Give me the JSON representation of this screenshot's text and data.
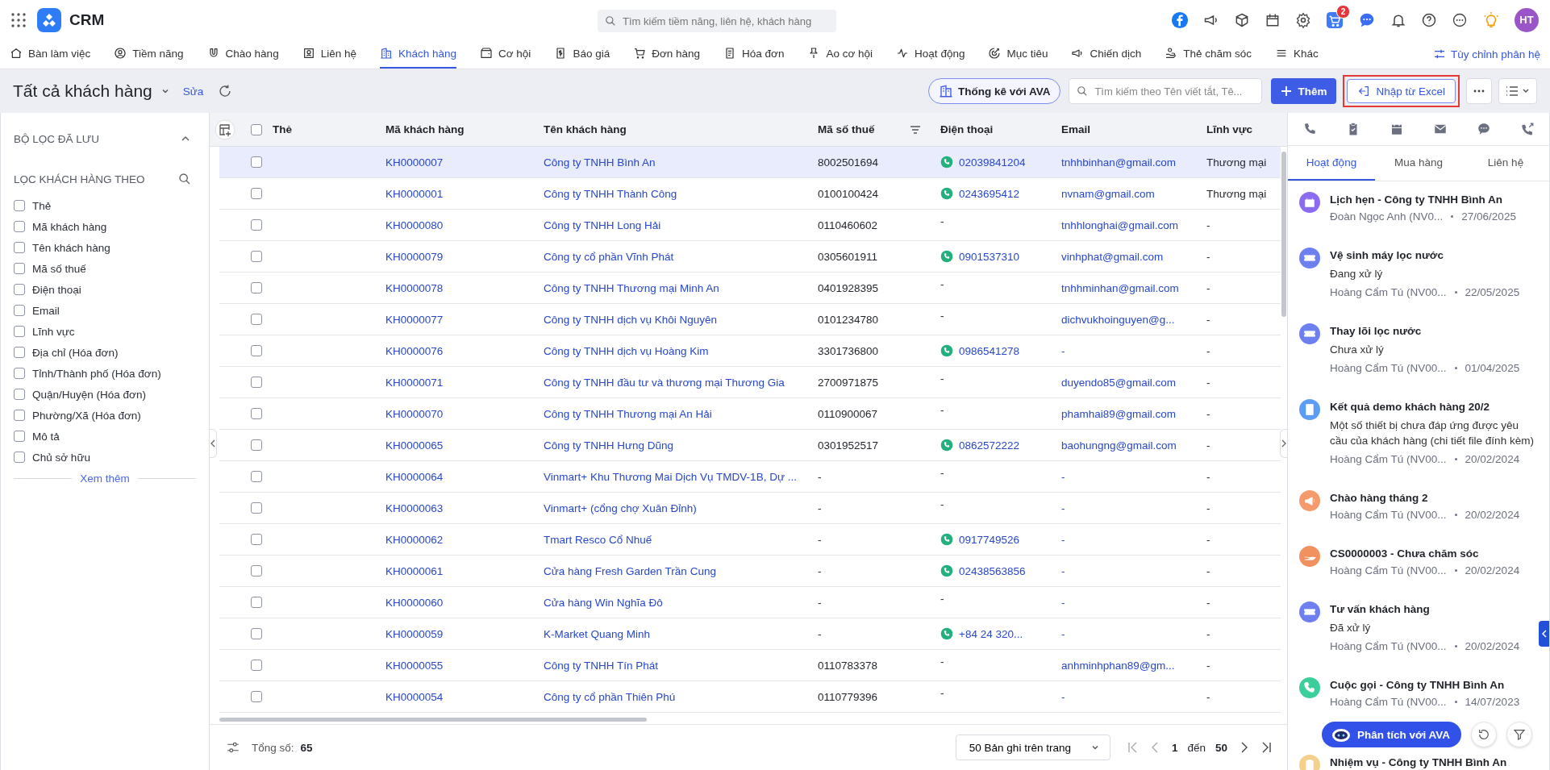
{
  "app": {
    "name": "CRM",
    "search_placeholder": "Tìm kiếm tiềm năng, liên hệ, khách hàng",
    "cart_badge": "2",
    "avatar": "HT"
  },
  "nav": {
    "items": [
      {
        "label": "Bàn làm việc",
        "selected": false
      },
      {
        "label": "Tiềm năng",
        "selected": false
      },
      {
        "label": "Chào hàng",
        "selected": false
      },
      {
        "label": "Liên hệ",
        "selected": false
      },
      {
        "label": "Khách hàng",
        "selected": true
      },
      {
        "label": "Cơ hội",
        "selected": false
      },
      {
        "label": "Báo giá",
        "selected": false
      },
      {
        "label": "Đơn hàng",
        "selected": false
      },
      {
        "label": "Hóa đơn",
        "selected": false
      },
      {
        "label": "Ao cơ hội",
        "selected": false
      },
      {
        "label": "Hoạt động",
        "selected": false
      },
      {
        "label": "Mục tiêu",
        "selected": false
      },
      {
        "label": "Chiến dịch",
        "selected": false
      },
      {
        "label": "Thẻ chăm sóc",
        "selected": false
      },
      {
        "label": "Khác",
        "selected": false
      }
    ],
    "customize": "Tùy chỉnh phân hệ"
  },
  "toolbar": {
    "title": "Tất cả khách hàng",
    "edit": "Sửa",
    "ava_button": "Thống kê với AVA",
    "search_placeholder": "Tìm kiếm theo Tên viết tắt, Tê...",
    "add_button": "Thêm",
    "import_button": {
      "label": "Nhập từ Excel",
      "highlighted": true
    }
  },
  "filters": {
    "saved_title": "BỘ LỌC ĐÃ LƯU",
    "filter_title": "LỌC KHÁCH HÀNG THEO",
    "items": [
      {
        "label": "Thẻ",
        "checked": false
      },
      {
        "label": "Mã khách hàng",
        "checked": false
      },
      {
        "label": "Tên khách hàng",
        "checked": false
      },
      {
        "label": "Mã số thuế",
        "checked": false
      },
      {
        "label": "Điện thoại",
        "checked": false
      },
      {
        "label": "Email",
        "checked": false
      },
      {
        "label": "Lĩnh vực",
        "checked": false
      },
      {
        "label": "Địa chỉ (Hóa đơn)",
        "checked": false
      },
      {
        "label": "Tỉnh/Thành phố (Hóa đơn)",
        "checked": false
      },
      {
        "label": "Quận/Huyện (Hóa đơn)",
        "checked": false
      },
      {
        "label": "Phường/Xã (Hóa đơn)",
        "checked": false
      },
      {
        "label": "Mô tả",
        "checked": false
      },
      {
        "label": "Chủ sở hữu",
        "checked": false
      }
    ],
    "more": "Xem thêm"
  },
  "table": {
    "columns": [
      "Thẻ",
      "Mã khách hàng",
      "Tên khách hàng",
      "Mã số thuế",
      "Điện thoại",
      "Email",
      "Lĩnh vực"
    ],
    "select_all_checked": false,
    "rows": [
      {
        "selected": true,
        "checked": false,
        "code": "KH0000007",
        "name": "Công ty TNHH Bình An",
        "tax_code": "8002501694",
        "phone": "02039841204",
        "phone_icon": true,
        "email": "tnhhbinhan@gmail.com",
        "field": "Thương mại"
      },
      {
        "selected": false,
        "checked": false,
        "code": "KH0000001",
        "name": "Công ty TNHH Thành Công",
        "tax_code": "0100100424",
        "phone": "0243695412",
        "phone_icon": true,
        "email": "nvnam@gmail.com",
        "field": "Thương mại"
      },
      {
        "selected": false,
        "checked": false,
        "code": "KH0000080",
        "name": "Công ty TNHH Long Hải",
        "tax_code": "0110460602",
        "phone": "-",
        "phone_icon": false,
        "email": "tnhhlonghai@gmail.com",
        "field": "-"
      },
      {
        "selected": false,
        "checked": false,
        "code": "KH0000079",
        "name": "Công ty cổ phần Vĩnh Phát",
        "tax_code": "0305601911",
        "phone": "0901537310",
        "phone_icon": true,
        "email": "vinhphat@gmail.com",
        "field": "-"
      },
      {
        "selected": false,
        "checked": false,
        "code": "KH0000078",
        "name": "Công ty TNHH Thương mại Minh An",
        "tax_code": "0401928395",
        "phone": "-",
        "phone_icon": false,
        "email": "tnhhminhan@gmail.com",
        "field": "-"
      },
      {
        "selected": false,
        "checked": false,
        "code": "KH0000077",
        "name": "Công ty TNHH dịch vụ Khôi Nguyên",
        "tax_code": "0101234780",
        "phone": "-",
        "phone_icon": false,
        "email": "dichvukhoinguyen@g...",
        "field": "-"
      },
      {
        "selected": false,
        "checked": false,
        "code": "KH0000076",
        "name": "Công ty TNHH dịch vụ Hoàng Kim",
        "tax_code": "3301736800",
        "phone": "0986541278",
        "phone_icon": true,
        "email": "-",
        "field": "-"
      },
      {
        "selected": false,
        "checked": false,
        "code": "KH0000071",
        "name": "Công ty TNHH đầu tư và thương mại Thương Gia",
        "tax_code": "2700971875",
        "phone": "-",
        "phone_icon": false,
        "email": "duyendo85@gmail.com",
        "field": "-"
      },
      {
        "selected": false,
        "checked": false,
        "code": "KH0000070",
        "name": "Công ty TNHH Thương mại An Hải",
        "tax_code": "0110900067",
        "phone": "-",
        "phone_icon": false,
        "email": "phamhai89@gmail.com",
        "field": "-"
      },
      {
        "selected": false,
        "checked": false,
        "code": "KH0000065",
        "name": "Công ty TNHH Hưng Dũng",
        "tax_code": "0301952517",
        "phone": "0862572222",
        "phone_icon": true,
        "email": "baohungng@gmail.com",
        "field": "-"
      },
      {
        "selected": false,
        "checked": false,
        "code": "KH0000064",
        "name": "Vinmart+ Khu Thương Mai Dịch Vụ TMDV-1B, Dự ...",
        "tax_code": "-",
        "phone": "-",
        "phone_icon": false,
        "email": "-",
        "field": "-"
      },
      {
        "selected": false,
        "checked": false,
        "code": "KH0000063",
        "name": "Vinmart+ (cổng chợ Xuân Đỉnh)",
        "tax_code": "-",
        "phone": "-",
        "phone_icon": false,
        "email": "-",
        "field": "-"
      },
      {
        "selected": false,
        "checked": false,
        "code": "KH0000062",
        "name": "Tmart Resco Cổ Nhuế",
        "tax_code": "-",
        "phone": "0917749526",
        "phone_icon": true,
        "email": "-",
        "field": "-"
      },
      {
        "selected": false,
        "checked": false,
        "code": "KH0000061",
        "name": "Cửa hàng Fresh Garden Trần Cung",
        "tax_code": "-",
        "phone": "02438563856",
        "phone_icon": true,
        "email": "-",
        "field": "-"
      },
      {
        "selected": false,
        "checked": false,
        "code": "KH0000060",
        "name": "Cửa hàng Win Nghĩa Đô",
        "tax_code": "-",
        "phone": "-",
        "phone_icon": false,
        "email": "-",
        "field": "-"
      },
      {
        "selected": false,
        "checked": false,
        "code": "KH0000059",
        "name": "K-Market Quang Minh",
        "tax_code": "-",
        "phone": "+84 24 320...",
        "phone_icon": true,
        "email": "-",
        "field": "-"
      },
      {
        "selected": false,
        "checked": false,
        "code": "KH0000055",
        "name": "Công ty TNHH Tín Phát",
        "tax_code": "0110783378",
        "phone": "-",
        "phone_icon": false,
        "email": "anhminhphan89@gm...",
        "field": "-"
      },
      {
        "selected": false,
        "checked": false,
        "code": "KH0000054",
        "name": "Công ty cổ phần Thiên Phú",
        "tax_code": "0110779396",
        "phone": "-",
        "phone_icon": false,
        "email": "-",
        "field": "-"
      }
    ]
  },
  "footer": {
    "total_label": "Tổng số:",
    "total": "65",
    "page_size": "50 Bản ghi trên trang",
    "page_from": "1",
    "page_to_label": "đến",
    "page_to": "50"
  },
  "panel": {
    "tabs": [
      {
        "label": "Hoạt động",
        "selected": true
      },
      {
        "label": "Mua hàng",
        "selected": false
      },
      {
        "label": "Liên hệ",
        "selected": false
      }
    ],
    "activities": [
      {
        "kind": "appointment",
        "title": "Lịch hẹn - Công ty TNHH Bình An",
        "author": "Đoàn Ngọc Anh (NV0...",
        "date": "27/06/2025"
      },
      {
        "kind": "ticket",
        "title": "Vệ sinh máy lọc nước",
        "status": "Đang xử lý",
        "author": "Hoàng Cẩm Tú (NV00...",
        "date": "22/05/2025"
      },
      {
        "kind": "ticket",
        "title": "Thay lõi lọc nước",
        "status": "Chưa xử lý",
        "author": "Hoàng Cẩm Tú (NV00...",
        "date": "01/04/2025"
      },
      {
        "kind": "note",
        "title": "Kết quả demo khách hàng 20/2",
        "status": "Một số thiết bị chưa đáp ứng được yêu cầu của khách hàng (chi tiết file đính kèm)",
        "author": "Hoàng Cẩm Tú (NV00...",
        "date": "20/02/2024"
      },
      {
        "kind": "campaign",
        "title": "Chào hàng tháng 2",
        "author": "Hoàng Cẩm Tú (NV00...",
        "date": "20/02/2024"
      },
      {
        "kind": "care",
        "title": "CS0000003 - Chưa chăm sóc",
        "author": "Hoàng Cẩm Tú (NV00...",
        "date": "20/02/2024"
      },
      {
        "kind": "ticket",
        "title": "Tư vấn khách hàng",
        "status": "Đã xử lý",
        "author": "Hoàng Cẩm Tú (NV00...",
        "date": "20/02/2024"
      },
      {
        "kind": "call",
        "title": "Cuộc gọi - Công ty TNHH Bình An",
        "author": "Hoàng Cẩm Tú (NV00...",
        "date": "14/07/2023"
      },
      {
        "kind": "task",
        "title": "Nhiệm vụ - Công ty TNHH Bình An"
      }
    ],
    "ava_button": "Phân tích với AVA"
  }
}
